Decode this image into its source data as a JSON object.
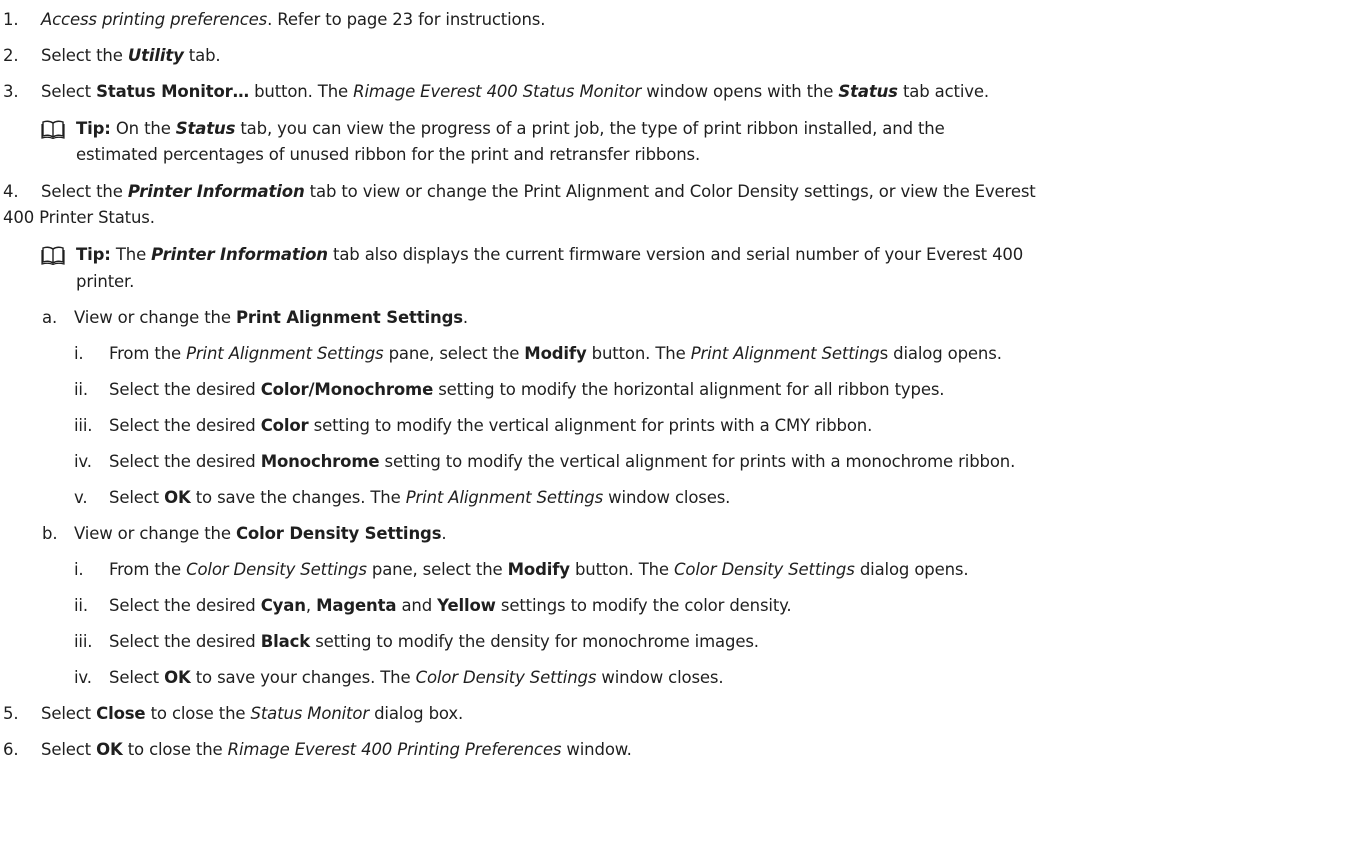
{
  "steps": [
    {
      "n": "1.",
      "parts": [
        [
          "i",
          "Access printing preferences"
        ],
        [
          "",
          ". Refer to page 23 for instructions."
        ]
      ]
    },
    {
      "n": "2.",
      "parts": [
        [
          "",
          "Select the "
        ],
        [
          "bi",
          "Utility"
        ],
        [
          "",
          " tab."
        ]
      ]
    },
    {
      "n": "3.",
      "parts": [
        [
          "",
          "Select "
        ],
        [
          "b",
          "Status Monitor…"
        ],
        [
          "",
          " button. The "
        ],
        [
          "i",
          "Rimage Everest 400 Status Monitor"
        ],
        [
          "",
          " window opens with the "
        ],
        [
          "bi",
          "Status"
        ],
        [
          "",
          " tab active."
        ]
      ]
    },
    {
      "n": "4.",
      "parts": [
        [
          "",
          "Select the "
        ],
        [
          "bi",
          "Printer Information"
        ],
        [
          "",
          " tab to view or change the Print Alignment and Color Density settings, or view the Everest"
        ]
      ],
      "cont": "400 Printer Status."
    },
    {
      "n": "5.",
      "parts": [
        [
          "",
          "Select "
        ],
        [
          "b",
          "Close"
        ],
        [
          "",
          " to close the "
        ],
        [
          "i",
          "Status Monitor"
        ],
        [
          "",
          " dialog box."
        ]
      ]
    },
    {
      "n": "6.",
      "parts": [
        [
          "",
          "Select "
        ],
        [
          "b",
          "OK"
        ],
        [
          "",
          " to close the "
        ],
        [
          "i",
          "Rimage Everest 400 Printing Preferences"
        ],
        [
          "",
          " window."
        ]
      ]
    }
  ],
  "tips": [
    {
      "parts": [
        [
          "b",
          "Tip:"
        ],
        [
          "",
          " On the "
        ],
        [
          "bi",
          "Status"
        ],
        [
          "",
          " tab, you can view the progress of a print job, the type of print ribbon installed, and the"
        ]
      ],
      "cont": "estimated percentages of unused ribbon for the print and retransfer ribbons."
    },
    {
      "parts": [
        [
          "b",
          "Tip:"
        ],
        [
          "",
          " The "
        ],
        [
          "bi",
          "Printer Information"
        ],
        [
          "",
          " tab also displays the current firmware version and serial number of your Everest 400"
        ]
      ],
      "cont": "printer."
    }
  ],
  "substeps": [
    {
      "n": "a.",
      "parts": [
        [
          "",
          "View or change the "
        ],
        [
          "b",
          "Print Alignment Settings"
        ],
        [
          "",
          "."
        ]
      ]
    },
    {
      "n": "b.",
      "parts": [
        [
          "",
          "View or change the "
        ],
        [
          "b",
          "Color Density Settings"
        ],
        [
          "",
          "."
        ]
      ]
    }
  ],
  "roman_a": [
    {
      "n": "i.",
      "parts": [
        [
          "",
          "From the "
        ],
        [
          "i",
          "Print Alignment Settings"
        ],
        [
          "",
          " pane, select the "
        ],
        [
          "b",
          "Modify"
        ],
        [
          "",
          " button. The "
        ],
        [
          "i",
          "Print Alignment Setting"
        ],
        [
          "",
          "s dialog opens."
        ]
      ]
    },
    {
      "n": "ii.",
      "parts": [
        [
          "",
          "Select the desired "
        ],
        [
          "b",
          "Color/Monochrome"
        ],
        [
          "",
          " setting to modify the horizontal alignment for all ribbon types."
        ]
      ]
    },
    {
      "n": "iii.",
      "parts": [
        [
          "",
          "Select the desired "
        ],
        [
          "b",
          "Color"
        ],
        [
          "",
          " setting to modify the vertical alignment for prints with a CMY ribbon."
        ]
      ]
    },
    {
      "n": "iv.",
      "parts": [
        [
          "",
          "Select the desired "
        ],
        [
          "b",
          "Monochrome"
        ],
        [
          "",
          " setting to modify the vertical alignment for prints with a monochrome ribbon."
        ]
      ]
    },
    {
      "n": "v.",
      "parts": [
        [
          "",
          "Select "
        ],
        [
          "b",
          "OK"
        ],
        [
          "",
          " to save the changes. The "
        ],
        [
          "i",
          "Print Alignment Settings"
        ],
        [
          "",
          " window closes."
        ]
      ]
    }
  ],
  "roman_b": [
    {
      "n": "i.",
      "parts": [
        [
          "",
          "From the "
        ],
        [
          "i",
          "Color Density Settings"
        ],
        [
          "",
          " pane, select the "
        ],
        [
          "b",
          "Modify"
        ],
        [
          "",
          " button. The "
        ],
        [
          "i",
          "Color Density Settings"
        ],
        [
          "",
          " dialog opens."
        ]
      ]
    },
    {
      "n": "ii.",
      "parts": [
        [
          "",
          "Select the desired "
        ],
        [
          "b",
          "Cyan"
        ],
        [
          "",
          ", "
        ],
        [
          "b",
          "Magenta"
        ],
        [
          "",
          " and "
        ],
        [
          "b",
          "Yellow"
        ],
        [
          "",
          " settings to modify the color density."
        ]
      ]
    },
    {
      "n": "iii.",
      "parts": [
        [
          "",
          "Select the desired "
        ],
        [
          "b",
          "Black"
        ],
        [
          "",
          " setting to modify the density for monochrome images."
        ]
      ]
    },
    {
      "n": "iv.",
      "parts": [
        [
          "",
          "Select "
        ],
        [
          "b",
          "OK"
        ],
        [
          "",
          " to save your changes. The "
        ],
        [
          "i",
          "Color Density Settings"
        ],
        [
          "",
          " window closes."
        ]
      ]
    }
  ],
  "icons": {
    "tip": "book-icon"
  }
}
